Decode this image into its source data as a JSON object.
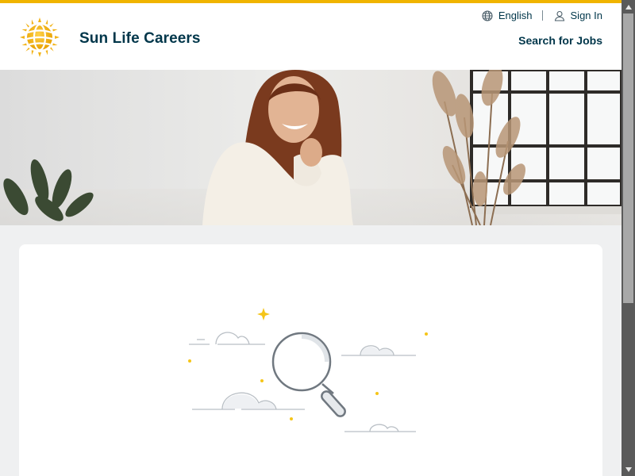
{
  "header": {
    "brand": "Sun Life Careers",
    "language_label": "English",
    "sign_in_label": "Sign In",
    "search_jobs_label": "Search for Jobs"
  },
  "icons": {
    "logo": "sun-logo-icon",
    "language": "globe-icon",
    "sign_in": "user-icon",
    "search": "magnifying-glass-icon"
  },
  "colors": {
    "accent": "#f0b400",
    "brand_text": "#00364a",
    "page_background": "#eff0f1",
    "card_background": "#ffffff"
  }
}
